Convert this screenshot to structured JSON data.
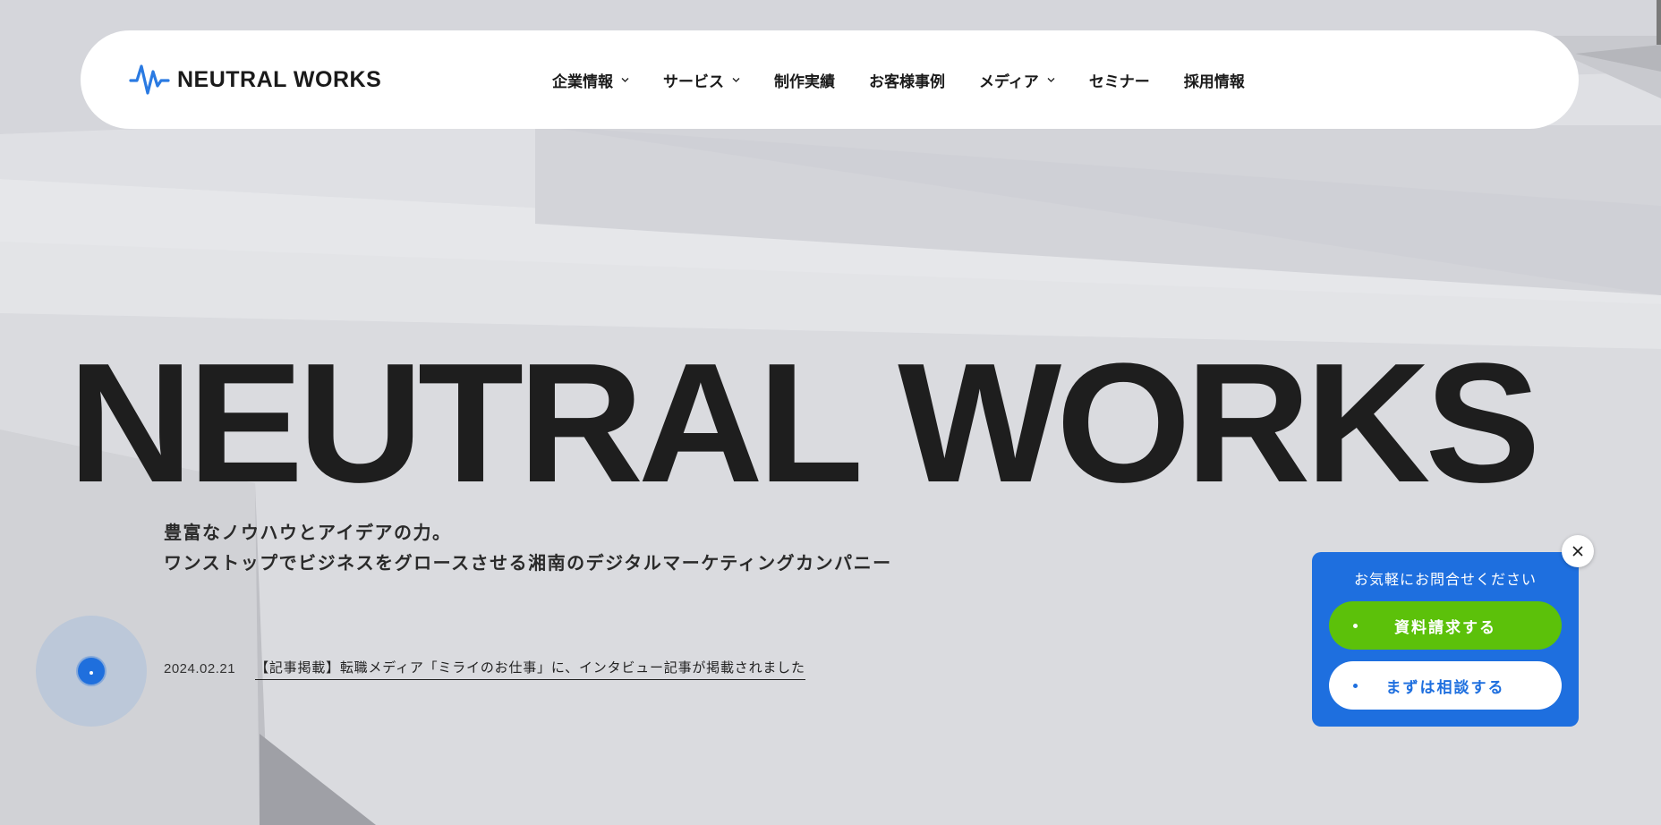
{
  "header": {
    "logo_text": "NEUTRAL WORKS",
    "nav": [
      {
        "label": "企業情報",
        "has_dropdown": true
      },
      {
        "label": "サービス",
        "has_dropdown": true
      },
      {
        "label": "制作実績",
        "has_dropdown": false
      },
      {
        "label": "お客様事例",
        "has_dropdown": false
      },
      {
        "label": "メディア",
        "has_dropdown": true
      },
      {
        "label": "セミナー",
        "has_dropdown": false
      },
      {
        "label": "採用情報",
        "has_dropdown": false
      }
    ]
  },
  "hero": {
    "title": "NEUTRAL WORKS",
    "tagline_line1": "豊富なノウハウとアイデアの力。",
    "tagline_line2": "ワンストップでビジネスをグロースさせる湘南のデジタルマーケティングカンパニー"
  },
  "news": {
    "date": "2024.02.21",
    "headline": "【記事掲載】転職メディア「ミライのお仕事」に、インタビュー記事が掲載されました"
  },
  "contact_widget": {
    "title": "お気軽にお問合せください",
    "request_docs_label": "資料請求する",
    "consult_label": "まずは相談する"
  },
  "colors": {
    "accent_blue": "#1e6fdf",
    "accent_green": "#5cc10a",
    "text_dark": "#1e1e1e"
  }
}
